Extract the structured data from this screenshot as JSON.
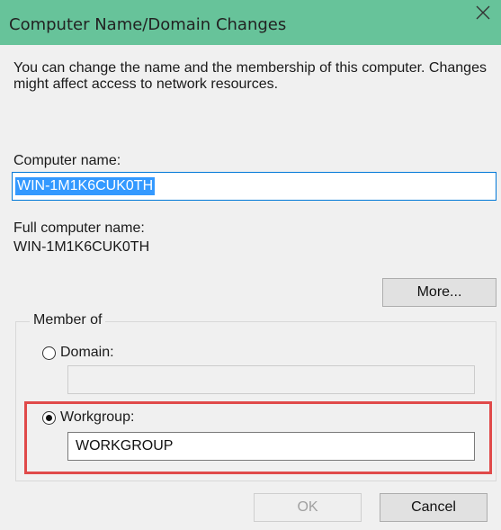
{
  "dialog": {
    "title": "Computer Name/Domain Changes",
    "close_icon": "close-icon",
    "description": "You can change the name and the membership of this computer. Changes might affect access to network resources."
  },
  "computer_name": {
    "label": "Computer name:",
    "value": "WIN-1M1K6CUK0TH"
  },
  "full_name": {
    "label": "Full computer name:",
    "value": "WIN-1M1K6CUK0TH"
  },
  "more_button": "More...",
  "member_of": {
    "legend": "Member of",
    "domain": {
      "label": "Domain:",
      "value": "",
      "selected": false
    },
    "workgroup": {
      "label": "Workgroup:",
      "value": "WORKGROUP",
      "selected": true
    }
  },
  "buttons": {
    "ok": "OK",
    "cancel": "Cancel"
  },
  "colors": {
    "titlebar": "#67c39a",
    "highlight": "#e04a4a",
    "selection": "#3399ff"
  }
}
